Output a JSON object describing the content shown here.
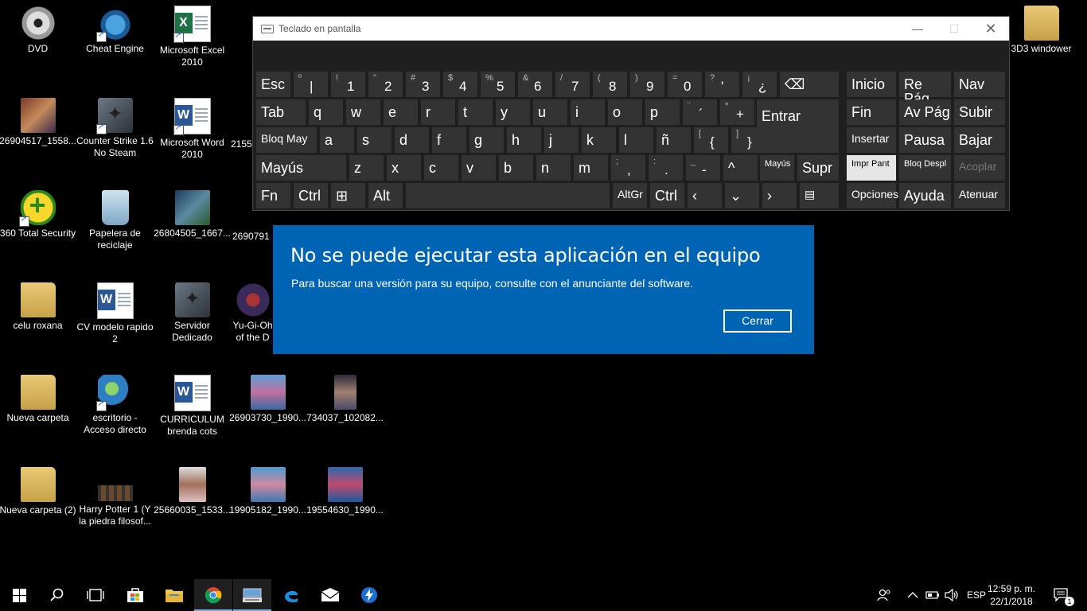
{
  "desktop": {
    "icons": [
      {
        "label": "DVD"
      },
      {
        "label": "Cheat Engine"
      },
      {
        "label": "Microsoft Excel 2010"
      },
      {
        "label": "3D3 windower"
      },
      {
        "label": "26904517_1558..."
      },
      {
        "label": "Counter Strike 1.6 No Steam"
      },
      {
        "label": "Microsoft Word 2010"
      },
      {
        "label": "2155"
      },
      {
        "label": "360 Total Security"
      },
      {
        "label": "Papelera de reciclaje"
      },
      {
        "label": "26804505_1667..."
      },
      {
        "label": "2690791"
      },
      {
        "label": "celu roxana"
      },
      {
        "label": "CV modelo rapido 2"
      },
      {
        "label": "Servidor Dedicado"
      },
      {
        "label": "Yu-Gi-Oh of the D"
      },
      {
        "label": "Nueva carpeta"
      },
      {
        "label": "escritorio - Acceso directo"
      },
      {
        "label": "CURRICULUM brenda cots"
      },
      {
        "label": "26903730_1990..."
      },
      {
        "label": "734037_102082..."
      },
      {
        "label": "Nueva carpeta (2)"
      },
      {
        "label": "Harry Potter 1 (Y la piedra filosof..."
      },
      {
        "label": "25660035_1533..."
      },
      {
        "label": "19905182_1990..."
      },
      {
        "label": "19554630_1990..."
      }
    ]
  },
  "keyboard": {
    "title": "Teclado en pantalla",
    "row1": [
      {
        "main": "Esc"
      },
      {
        "sub": "º",
        "main": "|"
      },
      {
        "sub": "!",
        "main": "1"
      },
      {
        "sub": "\"",
        "main": "2"
      },
      {
        "sub": "#",
        "main": "3"
      },
      {
        "sub": "$",
        "main": "4"
      },
      {
        "sub": "%",
        "main": "5"
      },
      {
        "sub": "&",
        "main": "6"
      },
      {
        "sub": "/",
        "main": "7"
      },
      {
        "sub": "(",
        "main": "8"
      },
      {
        "sub": ")",
        "main": "9"
      },
      {
        "sub": "=",
        "main": "0"
      },
      {
        "sub": "?",
        "main": "'"
      },
      {
        "sub": "¡",
        "main": "¿"
      },
      {
        "main": "⌫"
      }
    ],
    "row2": [
      "Tab",
      "q",
      "w",
      "e",
      "r",
      "t",
      "y",
      "u",
      "i",
      "o",
      "p"
    ],
    "row2_extra": [
      {
        "sub": "¨",
        "main": "´"
      },
      {
        "sub": "*",
        "main": "+"
      }
    ],
    "enter": "Entrar",
    "row3": [
      "Bloq May",
      "a",
      "s",
      "d",
      "f",
      "g",
      "h",
      "j",
      "k",
      "l",
      "ñ"
    ],
    "row3_extra": [
      {
        "sub": "[",
        "main": "{"
      },
      {
        "sub": "]",
        "main": "}"
      }
    ],
    "row4": [
      "Mayús",
      "z",
      "x",
      "c",
      "v",
      "b",
      "n",
      "m"
    ],
    "row4_extra": [
      {
        "sub": ";",
        "main": ","
      },
      {
        "sub": ":",
        "main": "."
      },
      {
        "sub": "_",
        "main": "-"
      }
    ],
    "row4_right": [
      "^",
      "Mayús",
      "Supr"
    ],
    "row5": [
      "Fn",
      "Ctrl",
      "⊞",
      "Alt",
      "",
      "AltGr",
      "Ctrl",
      "‹",
      "⌄",
      "›",
      "▤"
    ],
    "nav": [
      [
        "Inicio",
        "Re Pág",
        "Nav"
      ],
      [
        "Fin",
        "Av Pág",
        "Subir"
      ],
      [
        "Insertar",
        "Pausa",
        "Bajar"
      ],
      [
        "Impr Pant",
        "Bloq Despl",
        "Acoplar"
      ],
      [
        "Opciones",
        "Ayuda",
        "Atenuar"
      ]
    ]
  },
  "dialog": {
    "title": "No se puede ejecutar esta aplicación en el equipo",
    "message": "Para buscar una versión para su equipo, consulte con el anunciante del software.",
    "close_label": "Cerrar"
  },
  "taskbar": {
    "language": "ESP",
    "time": "12:59 p. m.",
    "date": "22/1/2018",
    "notification_count": "1"
  },
  "colors": {
    "dialog_bg": "#0064b4",
    "key_bg": "#333333",
    "keyboard_bg": "#1f1f1f"
  }
}
